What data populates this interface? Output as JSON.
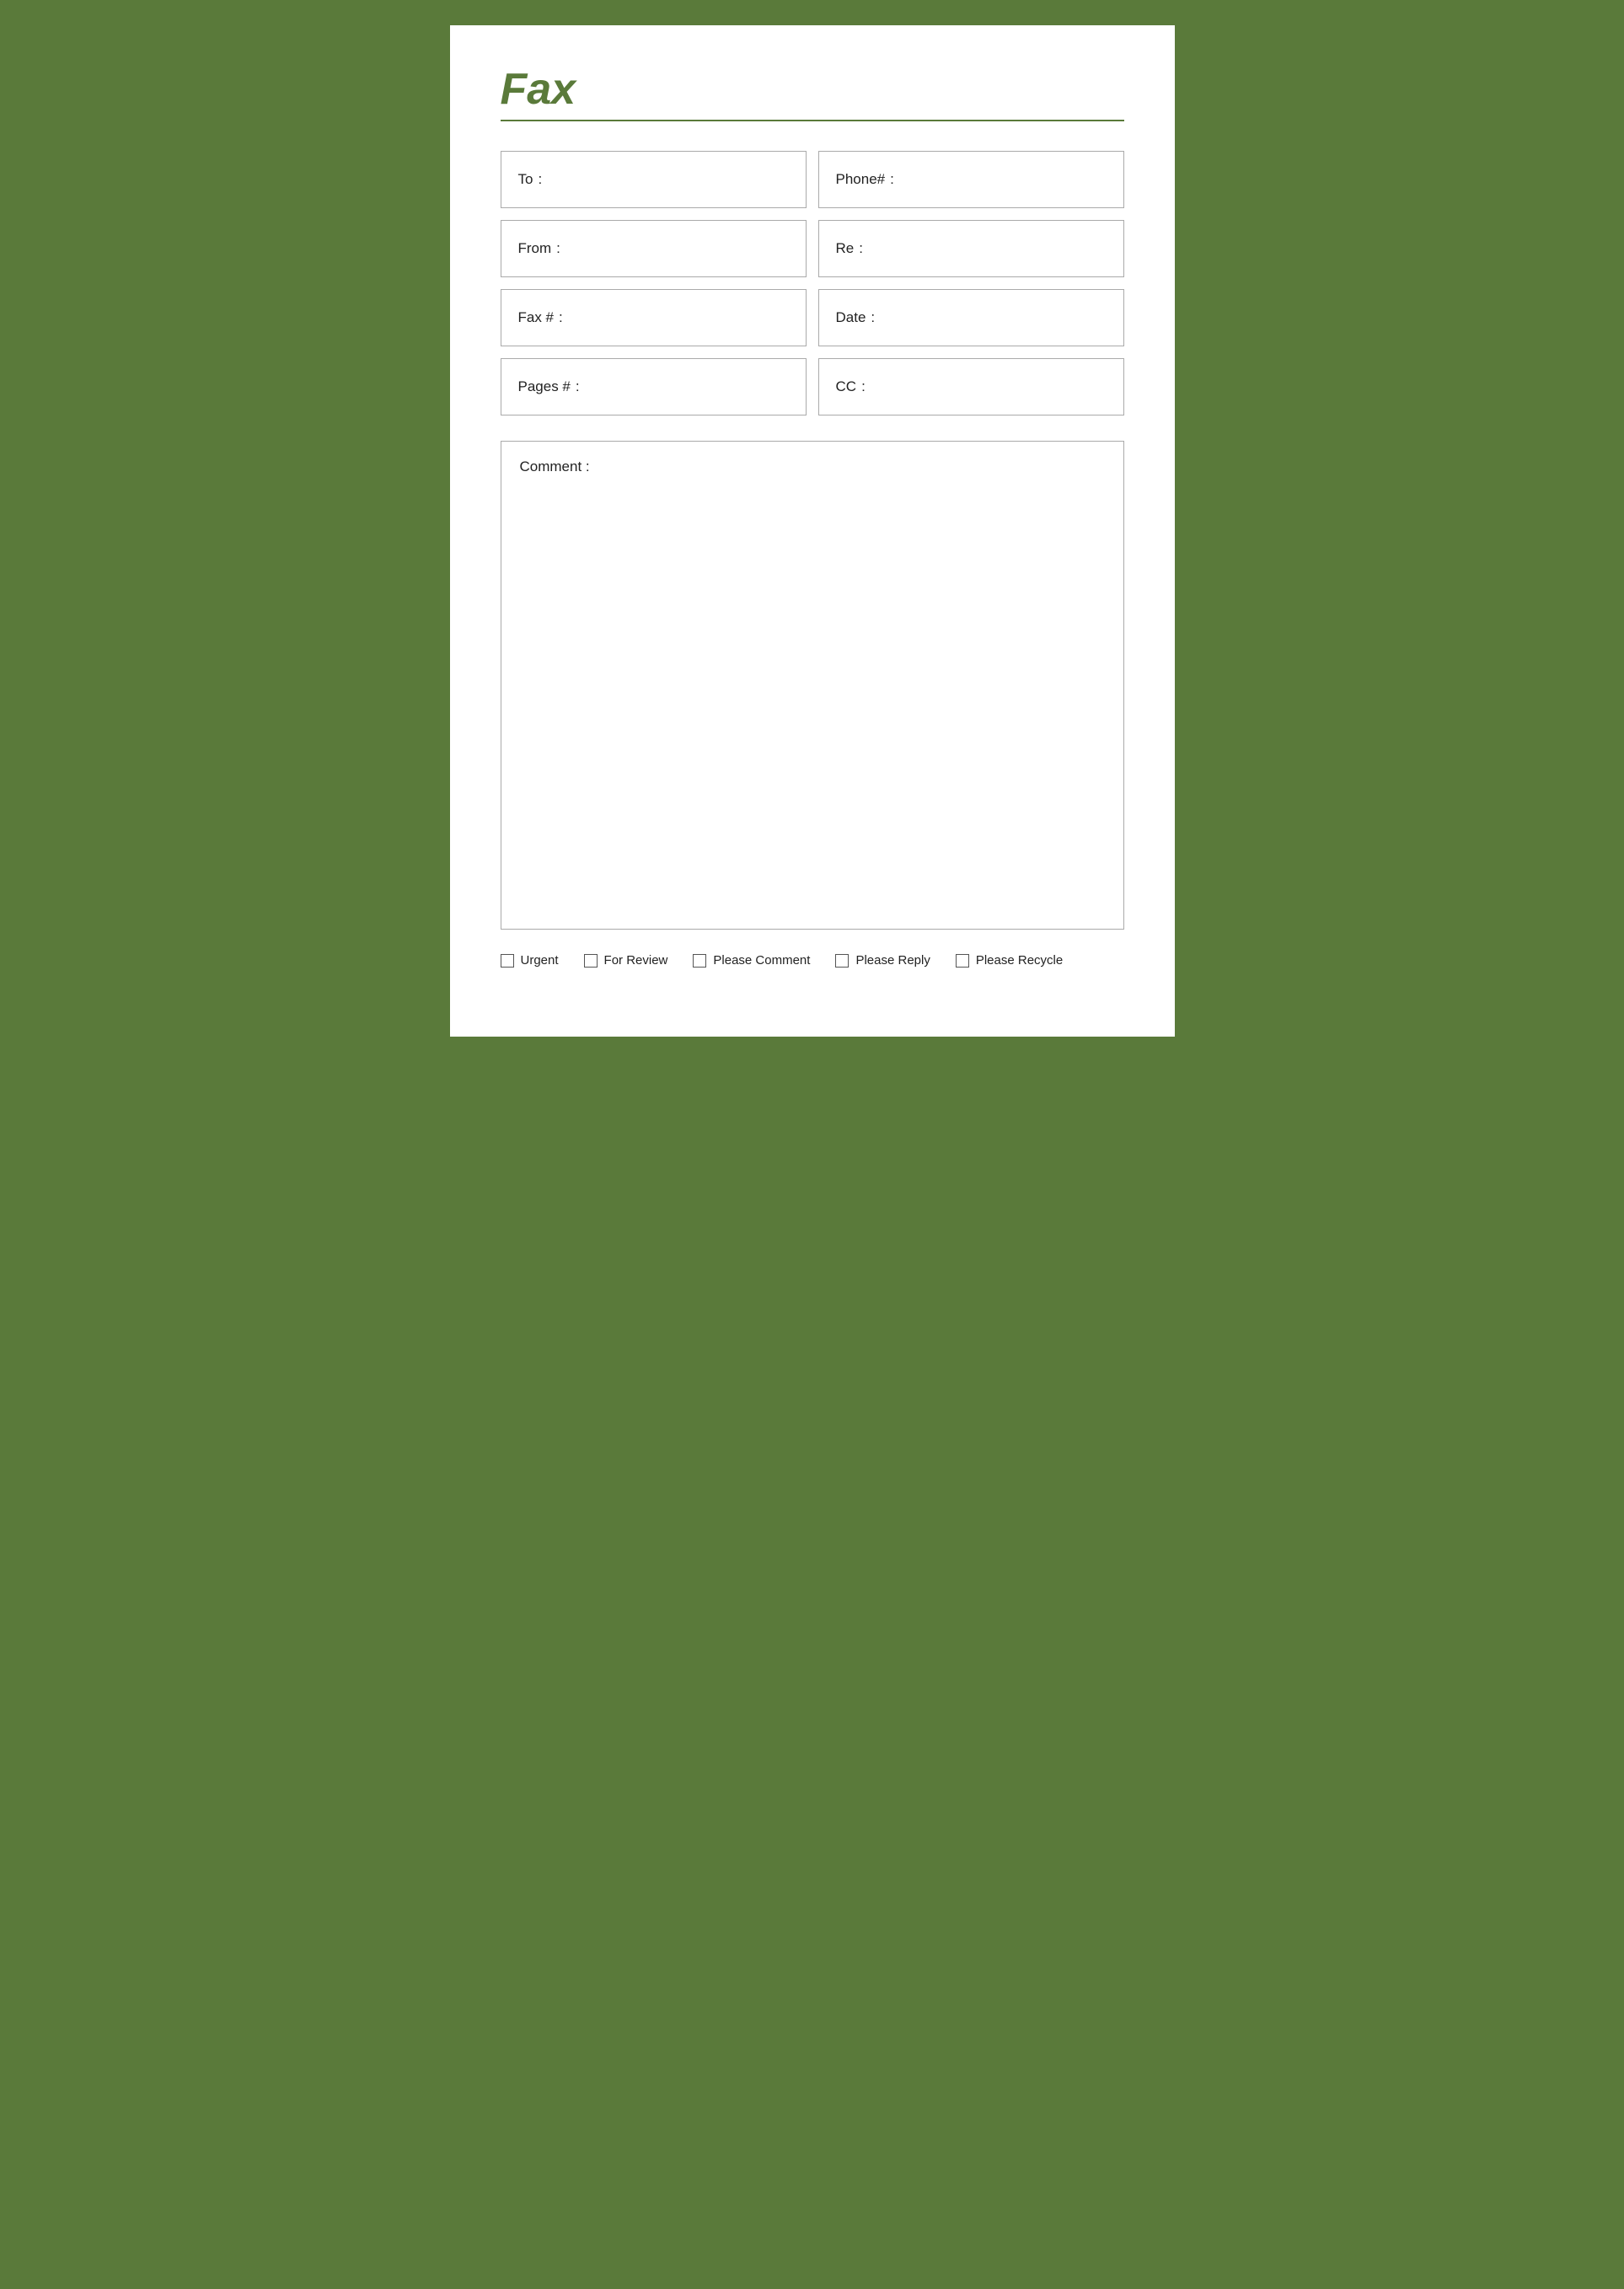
{
  "header": {
    "title": "Fax"
  },
  "fields": {
    "left": [
      {
        "label": "To",
        "colon": ":"
      },
      {
        "label": "From",
        "colon": ":"
      },
      {
        "label": "Fax #",
        "colon": ":"
      },
      {
        "label": "Pages #",
        "colon": ":"
      }
    ],
    "right": [
      {
        "label": "Phone#",
        "colon": ":"
      },
      {
        "label": "Re",
        "colon": ":"
      },
      {
        "label": "Date",
        "colon": ":"
      },
      {
        "label": "CC",
        "colon": ":"
      }
    ]
  },
  "comment": {
    "label": "Comment :"
  },
  "checkboxes": [
    {
      "label": "Urgent"
    },
    {
      "label": "For Review"
    },
    {
      "label": "Please Comment"
    },
    {
      "label": "Please Reply"
    },
    {
      "label": "Please Recycle"
    }
  ]
}
